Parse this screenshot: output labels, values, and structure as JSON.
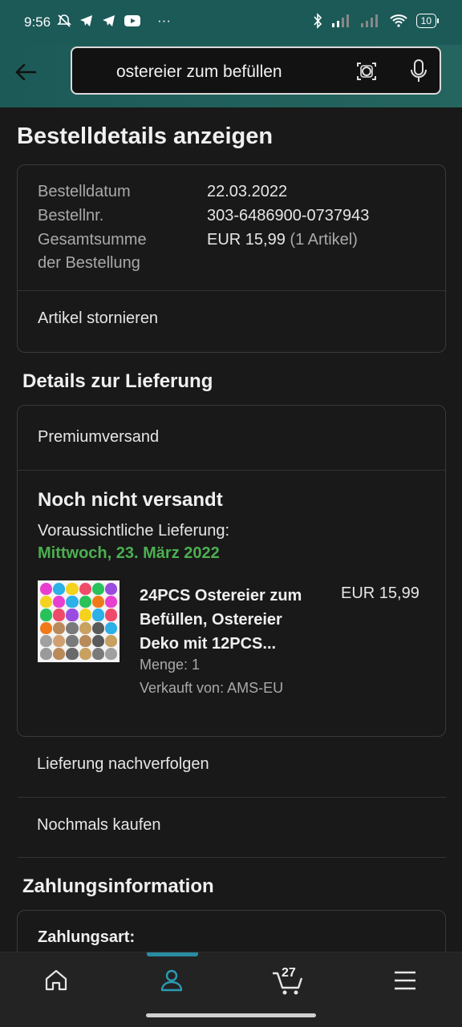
{
  "status_bar": {
    "time": "9:56",
    "left_icons": [
      "muted-bell-icon",
      "telegram-icon",
      "telegram-icon",
      "youtube-icon"
    ],
    "more": "···",
    "battery": "10"
  },
  "search": {
    "query": "ostereier zum befüllen"
  },
  "page_title": "Bestelldetails anzeigen",
  "order_summary": {
    "date_label": "Bestelldatum",
    "date_value": "22.03.2022",
    "number_label": "Bestellnr.",
    "number_value": "303-6486900-0737943",
    "total_label_1": "Gesamtsumme",
    "total_label_2": "der Bestellung",
    "total_value": "EUR 15,99",
    "total_items": "(1 Artikel)",
    "cancel_label": "Artikel stornieren"
  },
  "delivery": {
    "section_title": "Details zur Lieferung",
    "shipping_method": "Premiumversand",
    "status": "Noch nicht versandt",
    "expected_label": "Voraussichtliche Lieferung:",
    "expected_date": "Mittwoch, 23. März 2022",
    "item": {
      "title_line_1": "24PCS Ostereier zum",
      "title_line_2": "Befüllen, Ostereier",
      "title_line_3": "Deko mit 12PCS...",
      "price": "EUR 15,99",
      "quantity": "Menge: 1",
      "seller": "Verkauft von: AMS-EU"
    },
    "track_label": "Lieferung nachverfolgen",
    "buy_again_label": "Nochmals kaufen"
  },
  "payment": {
    "section_title": "Zahlungsinformation",
    "method_label": "Zahlungsart:"
  },
  "bottom_nav": {
    "cart_count": "27",
    "items": [
      "home-icon",
      "account-icon",
      "cart-icon",
      "menu-icon"
    ]
  },
  "colors": {
    "header_teal": "#1c5a58",
    "delivery_green": "#4caf50",
    "active_indicator": "#2a8ca2"
  }
}
